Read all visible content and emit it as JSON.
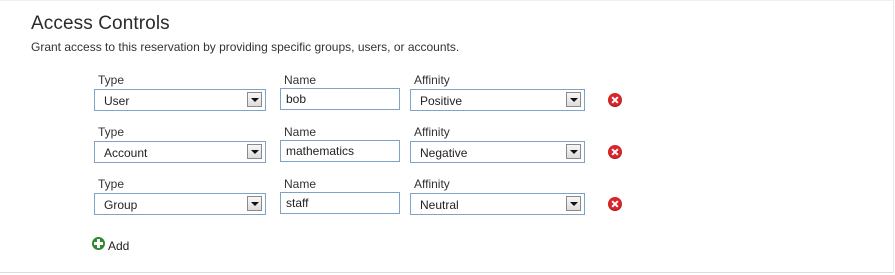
{
  "section": {
    "title": "Access Controls",
    "subtitle": "Grant access to this reservation by providing specific groups, users, or accounts."
  },
  "labels": {
    "type": "Type",
    "name": "Name",
    "affinity": "Affinity"
  },
  "rows": [
    {
      "type": "User",
      "name": "bob",
      "affinity": "Positive"
    },
    {
      "type": "Account",
      "name": "mathematics",
      "affinity": "Negative"
    },
    {
      "type": "Group",
      "name": "staff",
      "affinity": "Neutral"
    }
  ],
  "icons": {
    "remove": "remove-icon",
    "add": "add-icon",
    "dropdown": "chevron-down-icon"
  },
  "colors": {
    "remove": "#d9262b",
    "add": "#2f8a2f",
    "field_border": "#7fa3c6"
  },
  "add": {
    "label": "Add"
  }
}
